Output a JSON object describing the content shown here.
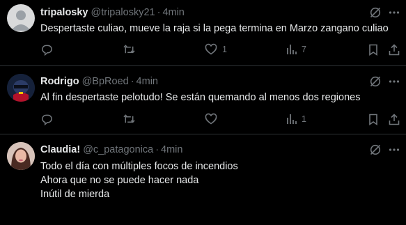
{
  "icons": {
    "reply": "reply-icon",
    "retweet": "retweet-icon",
    "like": "heart-icon",
    "views": "views-icon",
    "bookmark": "bookmark-icon",
    "share": "share-icon",
    "grok": "grok-icon",
    "more": "more-icon"
  },
  "colors": {
    "background": "#000000",
    "text": "#e7e9ea",
    "muted": "#71767b",
    "divider": "#2f3336"
  },
  "tweets": [
    {
      "name": "tripalosky",
      "handle": "@tripalosky21",
      "separator": "·",
      "time": "4min",
      "lines": [
        "Despertaste culiao, mueve la raja si la pega termina en Marzo zangano culiao"
      ],
      "likes": "1",
      "views": "7"
    },
    {
      "name": "Rodrigo",
      "handle": "@BpRoed",
      "separator": "·",
      "time": "4min",
      "lines": [
        "Al fin despertaste pelotudo! Se están quemando al menos dos regiones"
      ],
      "likes": "",
      "views": "1"
    },
    {
      "name": "Claudia!",
      "handle": "@c_patagonica",
      "separator": "·",
      "time": "4min",
      "lines": [
        "Todo el día con múltiples focos de incendios",
        "Ahora que no se puede hacer nada",
        "Inútil de mierda"
      ],
      "likes": "",
      "views": ""
    }
  ]
}
